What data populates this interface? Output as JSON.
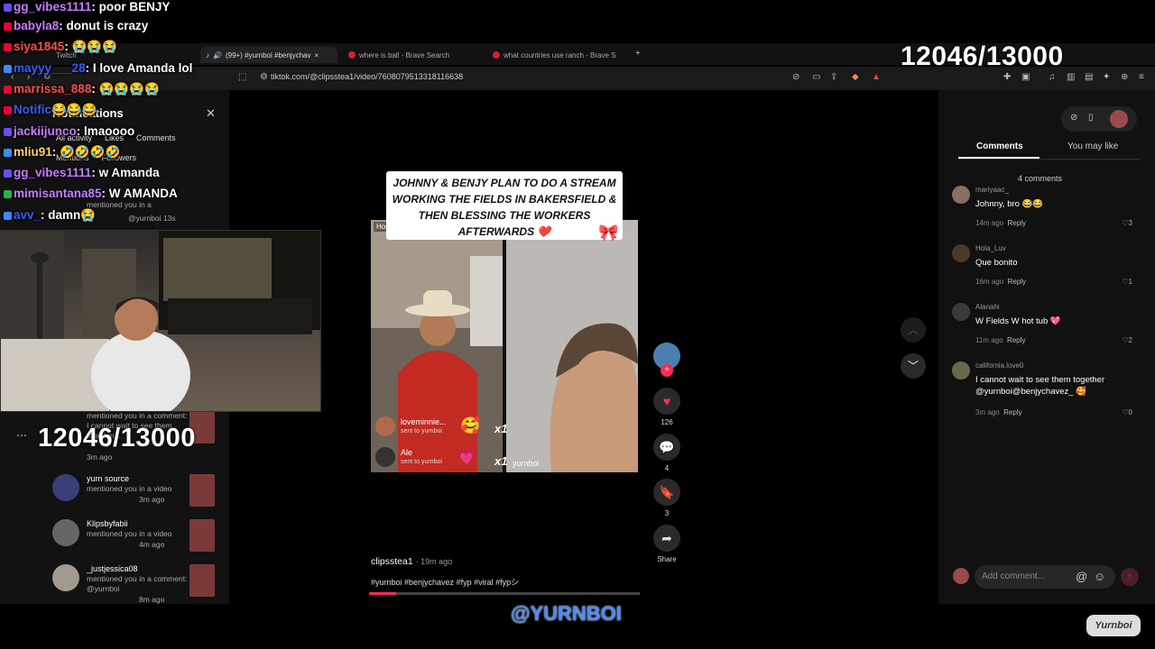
{
  "browser": {
    "tabs": [
      {
        "label": "(99+) #yurnboi #benjychav"
      },
      {
        "label": "where is ball - Brave Search"
      },
      {
        "label": "what countries use ranch - Brave S"
      }
    ],
    "twitch_label": "Twitch",
    "url": "tiktok.com/@clipsstea1/video/7608079513318116638"
  },
  "counter": {
    "top_right": "12046/13000",
    "left": "12046/13000"
  },
  "chat": [
    {
      "user": "gg_vibes1111",
      "msg": ": poor BENJY",
      "color": "#c77dff"
    },
    {
      "user": "babyla8",
      "msg": ": donut is crazy",
      "color": "#c77dff"
    },
    {
      "user": "siya1845",
      "msg": ": 😭😭😭",
      "color": "#ff4d4d"
    },
    {
      "user": "mayyy___28",
      "msg": ": I love Amanda lol",
      "color": "#3a5bff"
    },
    {
      "user": "marrissa_888",
      "msg": ": 😭😭😭😭",
      "color": "#ff4d4d"
    },
    {
      "user": "Notific",
      "msg": "😂😂😂",
      "color": "#3a5bff"
    },
    {
      "user": "jackiijunco",
      "msg": ": lmaoooo",
      "color": "#c77dff"
    },
    {
      "user": "mliu91",
      "msg": ": 🤣🤣🤣🤣",
      "color": "#ffd166"
    },
    {
      "user": "gg_vibes1111",
      "msg": ": w Amanda",
      "color": "#c77dff"
    },
    {
      "user": "mimisantana85",
      "msg": ": W AMANDA",
      "color": "#c77dff"
    },
    {
      "user": "avv_",
      "msg": ": damn😭",
      "color": "#3a5bff"
    }
  ],
  "notifications": {
    "title": "Notifications",
    "filters": [
      "All activity",
      "Likes",
      "Comments",
      "Mentions",
      "Followers"
    ],
    "items": [
      {
        "name": "",
        "text": "mentioned you in a comment: I cannot wait to see them together...",
        "time": "3m ago"
      },
      {
        "name": "yurn source",
        "text": "mentioned you in a video",
        "time": "3m ago"
      },
      {
        "name": "Klipsbyfabii",
        "text": "mentioned you in a video",
        "time": "4m ago"
      },
      {
        "name": "_justjessica08",
        "text": "mentioned you in a comment: @yurnboi",
        "time": "8m ago"
      }
    ],
    "mention_top": "mentioned you in a",
    "mention_top2": "@yurnboi 13s"
  },
  "video": {
    "caption": "JOHNNY & BENJY PLAN TO DO A STREAM WORKING THE FIELDS IN BAKERSFIELD & THEN BLESSING THE WORKERS AFTERWARDS ❤️",
    "host_label": "Host",
    "gift1_user": "loveminnie...",
    "gift1_sub": "sent to yurnboi",
    "gift2_user": "Ale",
    "gift2_sub": "sent to yurnboi",
    "x1": "x1",
    "x1b": "x1",
    "right_name": "yurnboi",
    "author": "clipsstea1",
    "posted": "· 19m ago",
    "tags": "#yurnboi #benjychavez #fyp #viral #fypシ",
    "likes": "126",
    "comments": "4",
    "saves": "3",
    "share": "Share",
    "progress": 0.1
  },
  "comments_panel": {
    "tab_comments": "Comments",
    "tab_like": "You may like",
    "count": "4 comments",
    "items": [
      {
        "user": "mariyaac_",
        "text": "Johnny, bro 😂😂",
        "time": "14m ago",
        "reply": "Reply",
        "likes": "3"
      },
      {
        "user": "Hola_Luv",
        "text": "Que bonito",
        "time": "16m ago",
        "reply": "Reply",
        "likes": "1"
      },
      {
        "user": "Alanahi",
        "text": "W Fields W hot tub 💖",
        "time": "11m ago",
        "reply": "Reply",
        "likes": "2"
      },
      {
        "user": "california.love0",
        "text": "I cannot wait to see them together @yurnboi@benjychavez_ 🥰",
        "time": "3m ago",
        "reply": "Reply",
        "likes": "0"
      }
    ],
    "add_placeholder": "Add comment..."
  },
  "watermark": "@YURNBOI",
  "corner_logo": "Yurnboi"
}
